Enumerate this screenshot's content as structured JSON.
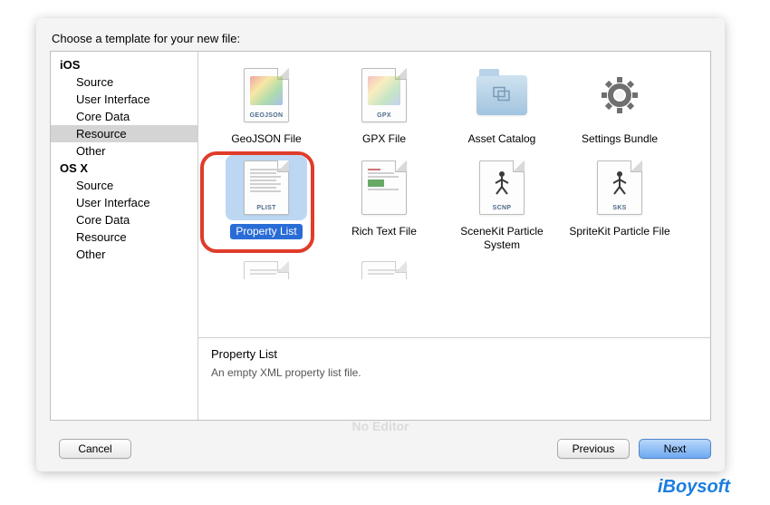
{
  "prompt": "Choose a template for your new file:",
  "sidebar": {
    "groups": [
      {
        "title": "iOS",
        "items": [
          "Source",
          "User Interface",
          "Core Data",
          "Resource",
          "Other"
        ]
      },
      {
        "title": "OS X",
        "items": [
          "Source",
          "User Interface",
          "Core Data",
          "Resource",
          "Other"
        ]
      }
    ],
    "selected": "Resource"
  },
  "templates": {
    "row1": [
      {
        "label": "GeoJSON File",
        "tag": "GEOJSON",
        "kind": "colorfile"
      },
      {
        "label": "GPX File",
        "tag": "GPX",
        "kind": "colorfile"
      },
      {
        "label": "Asset Catalog",
        "tag": "",
        "kind": "folder"
      },
      {
        "label": "Settings Bundle",
        "tag": "",
        "kind": "gear"
      }
    ],
    "row2": [
      {
        "label": "Property List",
        "tag": "PLIST",
        "kind": "linesfile",
        "selected": true,
        "highlighted": true
      },
      {
        "label": "Rich Text File",
        "tag": "",
        "kind": "richfile"
      },
      {
        "label": "SceneKit Particle System",
        "tag": "SCNP",
        "kind": "stick"
      },
      {
        "label": "SpriteKit Particle File",
        "tag": "SKS",
        "kind": "stick"
      }
    ],
    "row3": [
      {
        "label": "",
        "tag": "",
        "kind": "linesfile"
      },
      {
        "label": "",
        "tag": "",
        "kind": "linesfile"
      }
    ]
  },
  "description": {
    "title": "Property List",
    "body": "An empty XML property list file."
  },
  "buttons": {
    "cancel": "Cancel",
    "previous": "Previous",
    "next": "Next"
  },
  "noEditor": "No Editor",
  "watermark": "iBoysoft"
}
